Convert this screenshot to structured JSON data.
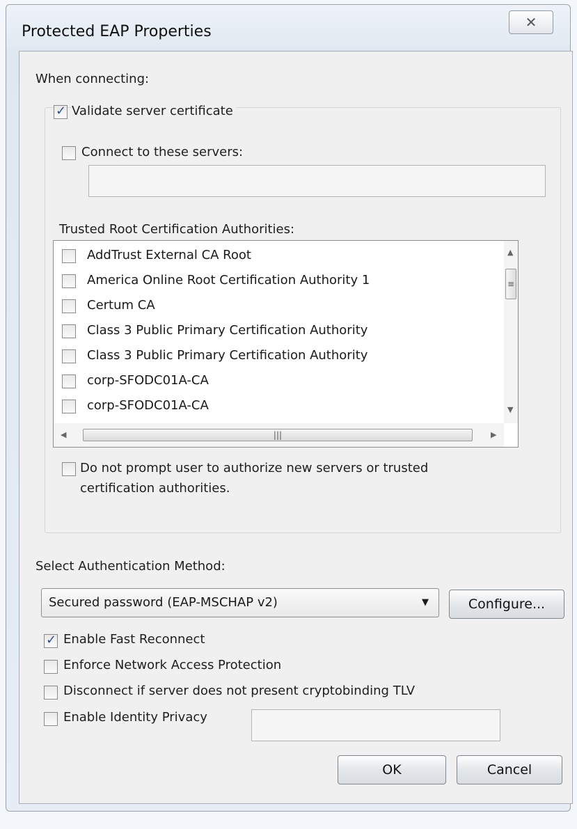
{
  "window": {
    "title": "Protected EAP Properties",
    "close_glyph": "✕",
    "close_icon": "close-icon"
  },
  "connecting": {
    "header": "When connecting:",
    "validate_server_certificate": {
      "label": "Validate server certificate",
      "checked": true
    },
    "connect_to_servers": {
      "label": "Connect to these servers:",
      "checked": false,
      "value": ""
    },
    "trusted_roots_label": "Trusted Root Certification Authorities:",
    "trusted_roots": [
      {
        "label": "AddTrust External CA Root",
        "checked": false
      },
      {
        "label": "America Online Root Certification Authority 1",
        "checked": false
      },
      {
        "label": "Certum CA",
        "checked": false
      },
      {
        "label": "Class 3 Public Primary Certification Authority",
        "checked": false
      },
      {
        "label": "Class 3 Public Primary Certification Authority",
        "checked": false
      },
      {
        "label": "corp-SFODC01A-CA",
        "checked": false
      },
      {
        "label": "corp-SFODC01A-CA",
        "checked": false
      }
    ],
    "no_prompt": {
      "label_line1": "Do not prompt user to authorize new servers or trusted",
      "label_line2": "certification authorities.",
      "checked": false
    }
  },
  "auth": {
    "header": "Select Authentication Method:",
    "selected": "Secured password (EAP-MSCHAP v2)",
    "configure_label": "Configure...",
    "options": [
      {
        "label": "Enable Fast Reconnect",
        "checked": true
      },
      {
        "label": "Enforce Network Access Protection",
        "checked": false
      },
      {
        "label": "Disconnect if server does not present cryptobinding TLV",
        "checked": false
      },
      {
        "label": "Enable Identity Privacy",
        "checked": false
      }
    ],
    "identity_value": ""
  },
  "buttons": {
    "ok": "OK",
    "cancel": "Cancel"
  },
  "colors": {
    "check": "#2a4f8a",
    "dialog_bg": "#f0f0f0"
  }
}
